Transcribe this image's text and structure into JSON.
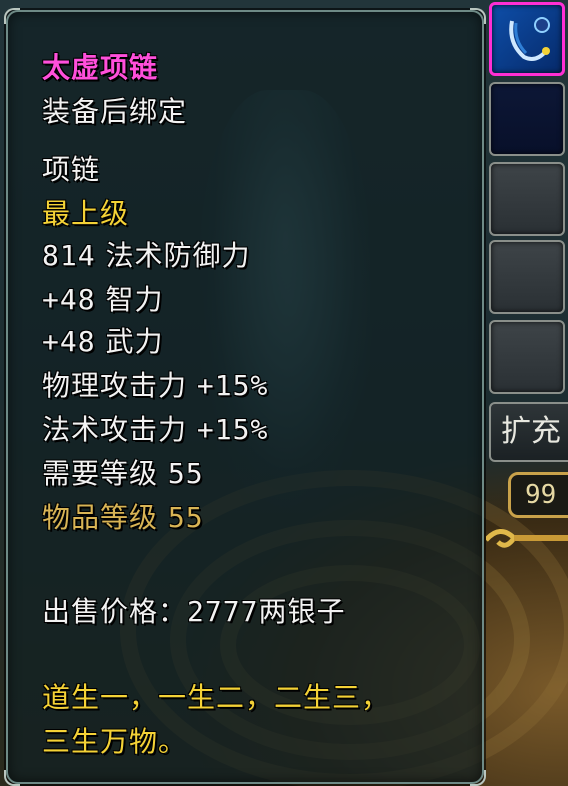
{
  "item": {
    "name": "太虚项链",
    "bind": "装备后绑定",
    "type": "项链",
    "grade": "最上级",
    "stats": [
      {
        "value": "814",
        "label": "法术防御力"
      },
      {
        "value": "+48",
        "label": "智力"
      },
      {
        "value": "+48",
        "label": "武力"
      }
    ],
    "bonuses": [
      {
        "label": "物理攻击力",
        "value": "+15%"
      },
      {
        "label": "法术攻击力",
        "value": "+15%"
      }
    ],
    "required_level": {
      "label": "需要等级",
      "value": "55"
    },
    "item_level": {
      "label": "物品等级",
      "value": "55"
    },
    "sell_price": {
      "label": "出售价格：",
      "value": "2777两银子"
    },
    "flavor": [
      "道生一，一生二，二生三，",
      "三生万物。"
    ]
  },
  "inventory": {
    "expand_label": "扩充",
    "count": "99"
  },
  "colors": {
    "name": "#ff4fdb",
    "grade": "#f4d236",
    "item_level_label": "#d8b455",
    "flavor": "#f4d236",
    "slot_highlight": "#ff2fd4"
  },
  "icons": {
    "active_slot": "necklace-icon"
  }
}
